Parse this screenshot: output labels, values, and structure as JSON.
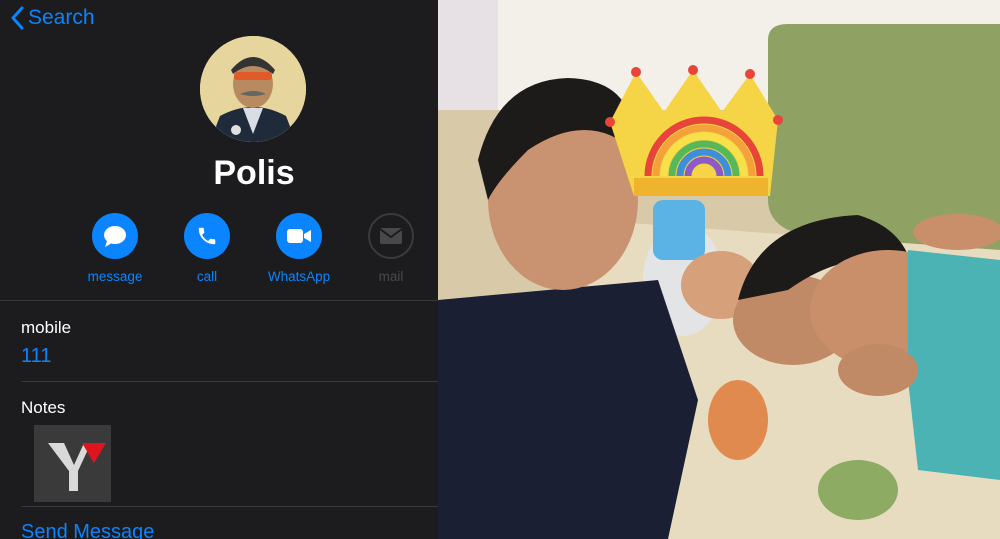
{
  "nav": {
    "back_label": "Search"
  },
  "contact": {
    "name": "Polis"
  },
  "actions": [
    {
      "label": "message",
      "icon": "message-icon"
    },
    {
      "label": "call",
      "icon": "phone-icon"
    },
    {
      "label": "WhatsApp",
      "icon": "video-icon"
    },
    {
      "label": "mail",
      "icon": "mail-icon"
    }
  ],
  "fields": {
    "mobile_label": "mobile",
    "mobile_value": "111",
    "notes_label": "Notes",
    "send_message": "Send Message"
  },
  "colors": {
    "accent": "#0a84ff",
    "panel_bg": "#1c1c1e",
    "separator": "#38383a"
  }
}
